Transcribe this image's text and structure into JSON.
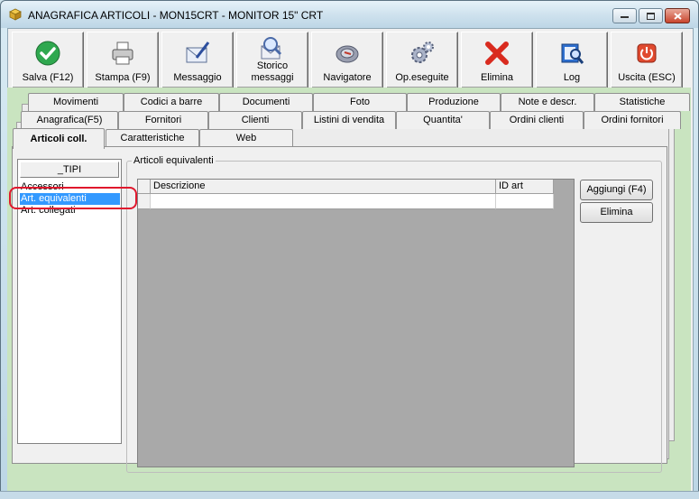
{
  "window": {
    "title": "ANAGRAFICA ARTICOLI - MON15CRT - MONITOR 15\" CRT",
    "controls": [
      "minimize",
      "maximize",
      "close"
    ]
  },
  "toolbar": [
    {
      "label": "Salva (F12)",
      "icon": "check-icon"
    },
    {
      "label": "Stampa (F9)",
      "icon": "printer-icon"
    },
    {
      "label": "Messaggio",
      "icon": "message-icon"
    },
    {
      "label": "Storico messaggi",
      "line1": "Storico",
      "line2": "messaggi",
      "icon": "message-history-icon"
    },
    {
      "label": "Navigatore",
      "icon": "navigator-icon"
    },
    {
      "label": "Op.eseguite",
      "icon": "operations-icon"
    },
    {
      "label": "Elimina",
      "icon": "delete-icon"
    },
    {
      "label": "Log",
      "icon": "log-icon"
    },
    {
      "label": "Uscita (ESC)",
      "icon": "exit-icon"
    }
  ],
  "tabs": {
    "row1": [
      "Movimenti",
      "Codici a barre",
      "Documenti",
      "Foto",
      "Produzione",
      "Note e descr.",
      "Statistiche"
    ],
    "row2": [
      "Anagrafica(F5)",
      "Fornitori",
      "Clienti",
      "Listini di vendita",
      "Quantita'",
      "Ordini clienti",
      "Ordini fornitori"
    ],
    "row3": [
      "Articoli coll.",
      "Caratteristiche",
      "Web"
    ],
    "active": "Articoli coll."
  },
  "types_list": {
    "header": "_TIPI",
    "items": [
      "Accessori",
      "Art. equivalenti",
      "Art. collegati"
    ],
    "selected": "Art. equivalenti"
  },
  "group": {
    "title": "Articoli equivalenti",
    "columns": [
      "Descrizione",
      "ID art"
    ],
    "rows": [
      [
        "",
        ""
      ]
    ]
  },
  "buttons": {
    "add": "Aggiungi (F4)",
    "delete": "Elimina"
  },
  "colors": {
    "accent_selection": "#3399ff",
    "highlight_ring": "#e0182d",
    "tab_background": "#c9e4c0",
    "grid_empty": "#a9a9a9"
  }
}
